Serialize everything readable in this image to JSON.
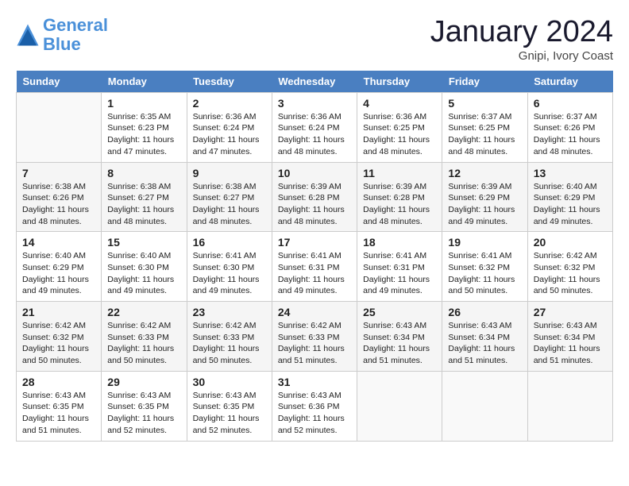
{
  "header": {
    "logo_line1": "General",
    "logo_line2": "Blue",
    "month": "January 2024",
    "location": "Gnipi, Ivory Coast"
  },
  "weekdays": [
    "Sunday",
    "Monday",
    "Tuesday",
    "Wednesday",
    "Thursday",
    "Friday",
    "Saturday"
  ],
  "weeks": [
    [
      {
        "day": "",
        "info": ""
      },
      {
        "day": "1",
        "info": "Sunrise: 6:35 AM\nSunset: 6:23 PM\nDaylight: 11 hours\nand 47 minutes."
      },
      {
        "day": "2",
        "info": "Sunrise: 6:36 AM\nSunset: 6:24 PM\nDaylight: 11 hours\nand 47 minutes."
      },
      {
        "day": "3",
        "info": "Sunrise: 6:36 AM\nSunset: 6:24 PM\nDaylight: 11 hours\nand 48 minutes."
      },
      {
        "day": "4",
        "info": "Sunrise: 6:36 AM\nSunset: 6:25 PM\nDaylight: 11 hours\nand 48 minutes."
      },
      {
        "day": "5",
        "info": "Sunrise: 6:37 AM\nSunset: 6:25 PM\nDaylight: 11 hours\nand 48 minutes."
      },
      {
        "day": "6",
        "info": "Sunrise: 6:37 AM\nSunset: 6:26 PM\nDaylight: 11 hours\nand 48 minutes."
      }
    ],
    [
      {
        "day": "7",
        "info": "Sunrise: 6:38 AM\nSunset: 6:26 PM\nDaylight: 11 hours\nand 48 minutes."
      },
      {
        "day": "8",
        "info": "Sunrise: 6:38 AM\nSunset: 6:27 PM\nDaylight: 11 hours\nand 48 minutes."
      },
      {
        "day": "9",
        "info": "Sunrise: 6:38 AM\nSunset: 6:27 PM\nDaylight: 11 hours\nand 48 minutes."
      },
      {
        "day": "10",
        "info": "Sunrise: 6:39 AM\nSunset: 6:28 PM\nDaylight: 11 hours\nand 48 minutes."
      },
      {
        "day": "11",
        "info": "Sunrise: 6:39 AM\nSunset: 6:28 PM\nDaylight: 11 hours\nand 48 minutes."
      },
      {
        "day": "12",
        "info": "Sunrise: 6:39 AM\nSunset: 6:29 PM\nDaylight: 11 hours\nand 49 minutes."
      },
      {
        "day": "13",
        "info": "Sunrise: 6:40 AM\nSunset: 6:29 PM\nDaylight: 11 hours\nand 49 minutes."
      }
    ],
    [
      {
        "day": "14",
        "info": "Sunrise: 6:40 AM\nSunset: 6:29 PM\nDaylight: 11 hours\nand 49 minutes."
      },
      {
        "day": "15",
        "info": "Sunrise: 6:40 AM\nSunset: 6:30 PM\nDaylight: 11 hours\nand 49 minutes."
      },
      {
        "day": "16",
        "info": "Sunrise: 6:41 AM\nSunset: 6:30 PM\nDaylight: 11 hours\nand 49 minutes."
      },
      {
        "day": "17",
        "info": "Sunrise: 6:41 AM\nSunset: 6:31 PM\nDaylight: 11 hours\nand 49 minutes."
      },
      {
        "day": "18",
        "info": "Sunrise: 6:41 AM\nSunset: 6:31 PM\nDaylight: 11 hours\nand 49 minutes."
      },
      {
        "day": "19",
        "info": "Sunrise: 6:41 AM\nSunset: 6:32 PM\nDaylight: 11 hours\nand 50 minutes."
      },
      {
        "day": "20",
        "info": "Sunrise: 6:42 AM\nSunset: 6:32 PM\nDaylight: 11 hours\nand 50 minutes."
      }
    ],
    [
      {
        "day": "21",
        "info": "Sunrise: 6:42 AM\nSunset: 6:32 PM\nDaylight: 11 hours\nand 50 minutes."
      },
      {
        "day": "22",
        "info": "Sunrise: 6:42 AM\nSunset: 6:33 PM\nDaylight: 11 hours\nand 50 minutes."
      },
      {
        "day": "23",
        "info": "Sunrise: 6:42 AM\nSunset: 6:33 PM\nDaylight: 11 hours\nand 50 minutes."
      },
      {
        "day": "24",
        "info": "Sunrise: 6:42 AM\nSunset: 6:33 PM\nDaylight: 11 hours\nand 51 minutes."
      },
      {
        "day": "25",
        "info": "Sunrise: 6:43 AM\nSunset: 6:34 PM\nDaylight: 11 hours\nand 51 minutes."
      },
      {
        "day": "26",
        "info": "Sunrise: 6:43 AM\nSunset: 6:34 PM\nDaylight: 11 hours\nand 51 minutes."
      },
      {
        "day": "27",
        "info": "Sunrise: 6:43 AM\nSunset: 6:34 PM\nDaylight: 11 hours\nand 51 minutes."
      }
    ],
    [
      {
        "day": "28",
        "info": "Sunrise: 6:43 AM\nSunset: 6:35 PM\nDaylight: 11 hours\nand 51 minutes."
      },
      {
        "day": "29",
        "info": "Sunrise: 6:43 AM\nSunset: 6:35 PM\nDaylight: 11 hours\nand 52 minutes."
      },
      {
        "day": "30",
        "info": "Sunrise: 6:43 AM\nSunset: 6:35 PM\nDaylight: 11 hours\nand 52 minutes."
      },
      {
        "day": "31",
        "info": "Sunrise: 6:43 AM\nSunset: 6:36 PM\nDaylight: 11 hours\nand 52 minutes."
      },
      {
        "day": "",
        "info": ""
      },
      {
        "day": "",
        "info": ""
      },
      {
        "day": "",
        "info": ""
      }
    ]
  ]
}
